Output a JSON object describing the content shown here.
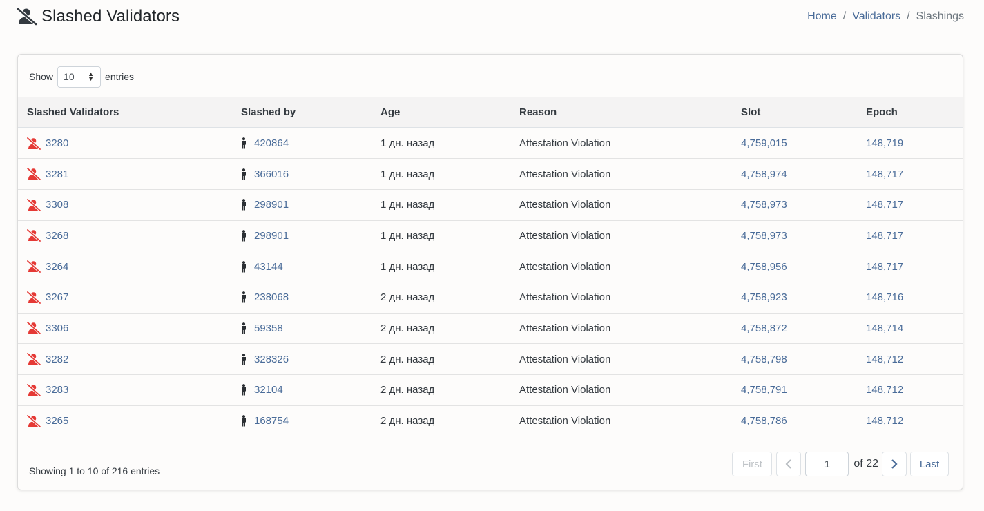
{
  "header": {
    "title": "Slashed Validators",
    "breadcrumb": [
      "Home",
      "Validators",
      "Slashings"
    ]
  },
  "length_menu": {
    "show_label": "Show",
    "selected": "10",
    "entries_label": "entries"
  },
  "table": {
    "columns": [
      "Slashed Validators",
      "Slashed by",
      "Age",
      "Reason",
      "Slot",
      "Epoch"
    ],
    "rows": [
      {
        "validator": "3280",
        "slashed_by": "420864",
        "age": "1 дн. назад",
        "reason": "Attestation Violation",
        "slot": "4,759,015",
        "epoch": "148,719"
      },
      {
        "validator": "3281",
        "slashed_by": "366016",
        "age": "1 дн. назад",
        "reason": "Attestation Violation",
        "slot": "4,758,974",
        "epoch": "148,717"
      },
      {
        "validator": "3308",
        "slashed_by": "298901",
        "age": "1 дн. назад",
        "reason": "Attestation Violation",
        "slot": "4,758,973",
        "epoch": "148,717"
      },
      {
        "validator": "3268",
        "slashed_by": "298901",
        "age": "1 дн. назад",
        "reason": "Attestation Violation",
        "slot": "4,758,973",
        "epoch": "148,717"
      },
      {
        "validator": "3264",
        "slashed_by": "43144",
        "age": "1 дн. назад",
        "reason": "Attestation Violation",
        "slot": "4,758,956",
        "epoch": "148,717"
      },
      {
        "validator": "3267",
        "slashed_by": "238068",
        "age": "2 дн. назад",
        "reason": "Attestation Violation",
        "slot": "4,758,923",
        "epoch": "148,716"
      },
      {
        "validator": "3306",
        "slashed_by": "59358",
        "age": "2 дн. назад",
        "reason": "Attestation Violation",
        "slot": "4,758,872",
        "epoch": "148,714"
      },
      {
        "validator": "3282",
        "slashed_by": "328326",
        "age": "2 дн. назад",
        "reason": "Attestation Violation",
        "slot": "4,758,798",
        "epoch": "148,712"
      },
      {
        "validator": "3283",
        "slashed_by": "32104",
        "age": "2 дн. назад",
        "reason": "Attestation Violation",
        "slot": "4,758,791",
        "epoch": "148,712"
      },
      {
        "validator": "3265",
        "slashed_by": "168754",
        "age": "2 дн. назад",
        "reason": "Attestation Violation",
        "slot": "4,758,786",
        "epoch": "148,712"
      }
    ]
  },
  "footer": {
    "info": "Showing 1 to 10 of 216 entries",
    "pagination": {
      "first": "First",
      "current_page": "1",
      "of_label": "of 22",
      "last": "Last"
    }
  },
  "icons": {
    "title_icon": "user-slash-icon",
    "row_validator_icon": "user-slash-icon",
    "row_slasher_icon": "person-icon",
    "prev_icon": "chevron-left-icon",
    "next_icon": "chevron-right-icon"
  },
  "colors": {
    "link": "#4a6c99",
    "slash_icon": "#e53935",
    "title_icon": "#343a40"
  }
}
